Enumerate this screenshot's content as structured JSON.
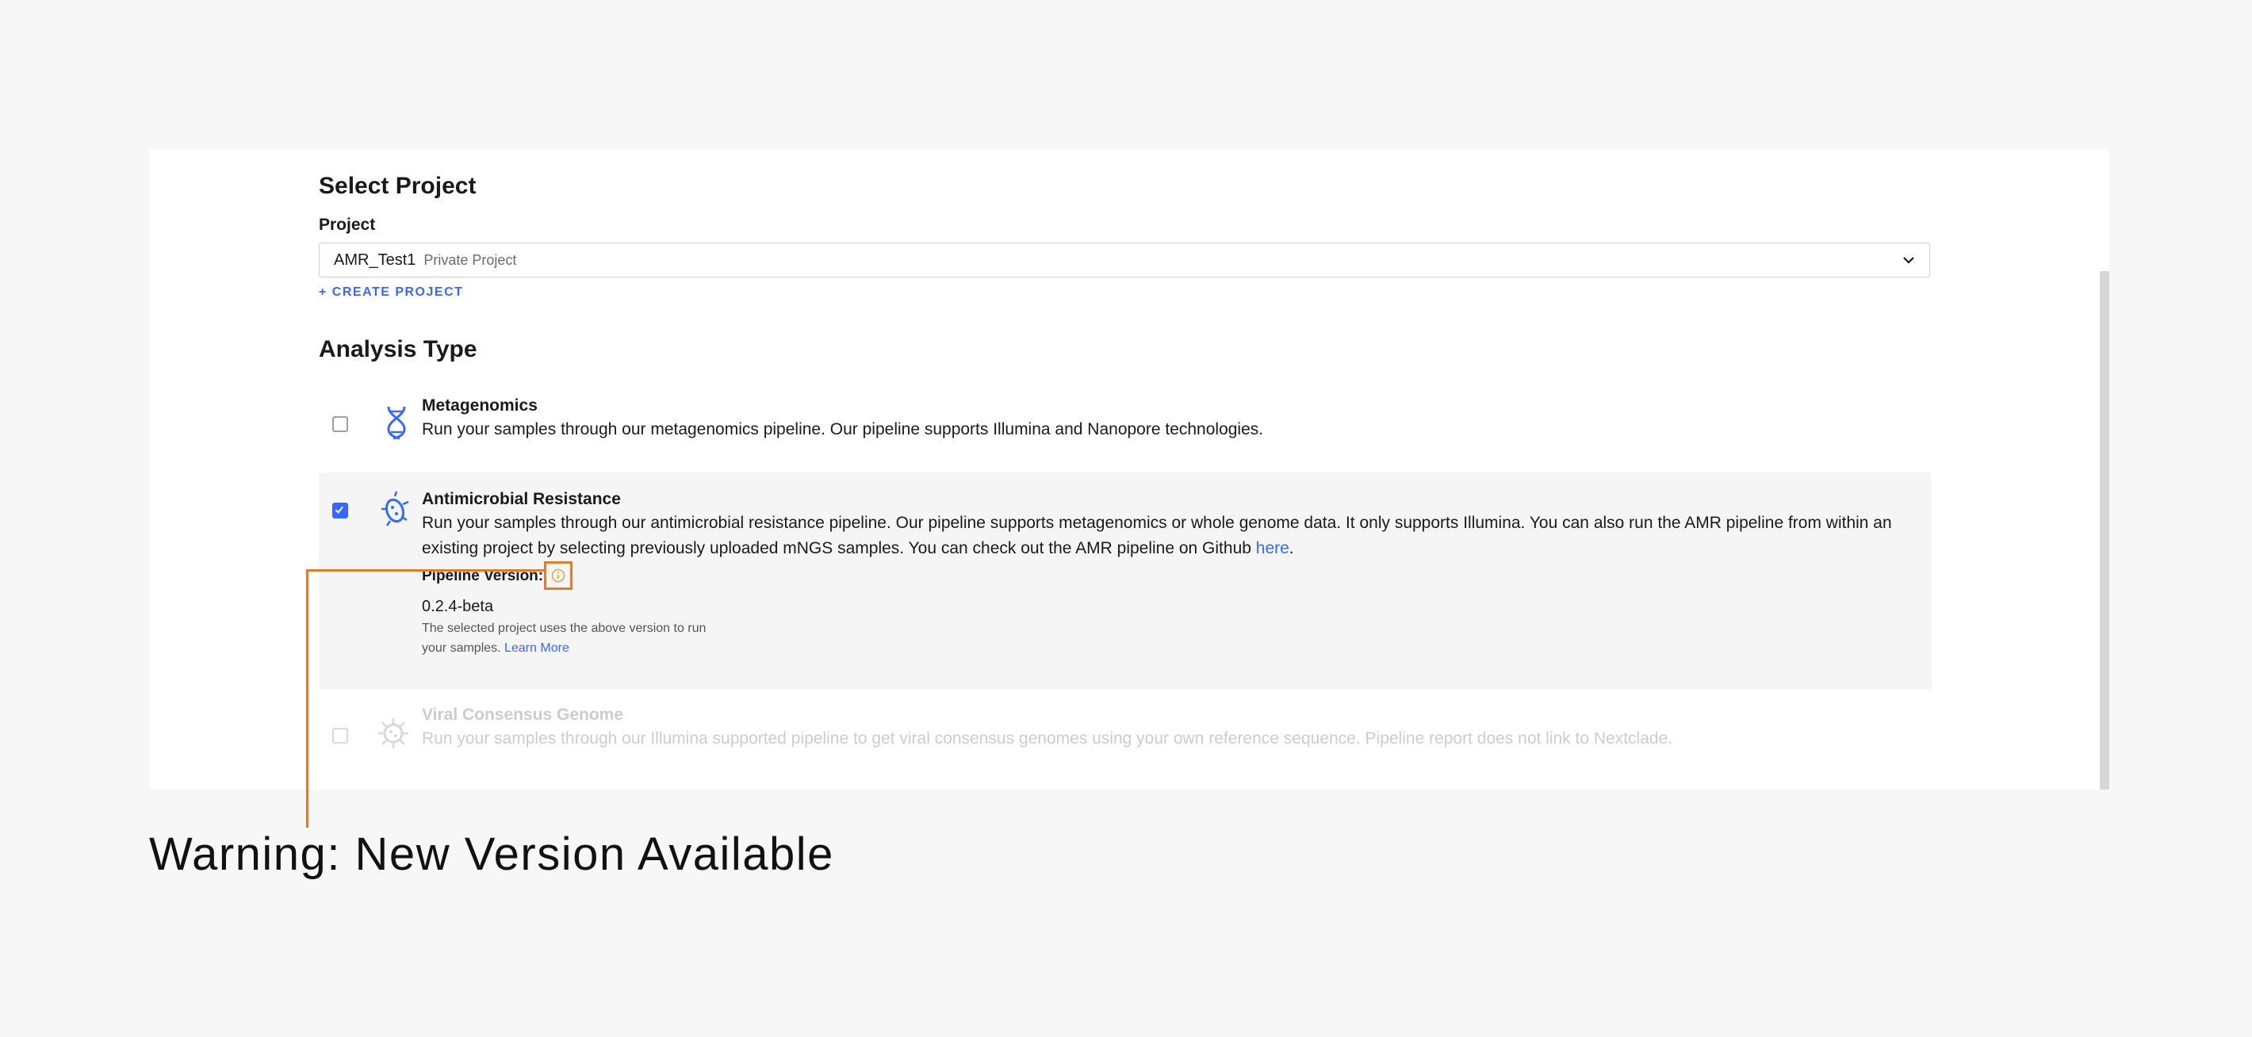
{
  "select_project": {
    "title": "Select Project",
    "field_label": "Project",
    "selected_name": "AMR_Test1",
    "selected_tag": "Private Project",
    "create_link": "+ CREATE PROJECT"
  },
  "analysis": {
    "title": "Analysis Type",
    "options": [
      {
        "title": "Metagenomics",
        "description": "Run your samples through our metagenomics pipeline. Our pipeline supports Illumina and Nanopore technologies.",
        "checked": false,
        "icon": "dna-icon"
      },
      {
        "title": "Antimicrobial Resistance",
        "description_1": "Run your samples through our antimicrobial resistance pipeline. Our pipeline supports metagenomics or whole genome data. It only supports Illumina. You can also run the AMR pipeline from within an existing project by selecting previously uploaded mNGS samples. You can check out the AMR pipeline on Github ",
        "link_text": "here",
        "description_end": ".",
        "checked": true,
        "icon": "bacterium-icon",
        "pipeline_version_label": "Pipeline Version:",
        "pipeline_version": "0.2.4-beta",
        "note": "The selected project uses the above version to run your samples.",
        "learn_more": "Learn More"
      },
      {
        "title": "Viral Consensus Genome",
        "description": "Run your samples through our Illumina supported pipeline to get viral consensus genomes using your own reference sequence. Pipeline report does not link to Nextclade.",
        "checked": false,
        "disabled": true,
        "icon": "virus-icon"
      }
    ]
  },
  "annotation": "Warning: New Version Available",
  "colors": {
    "accent": "#3867fa",
    "callout": "#e07a2c",
    "disabled": "#cccccc"
  }
}
